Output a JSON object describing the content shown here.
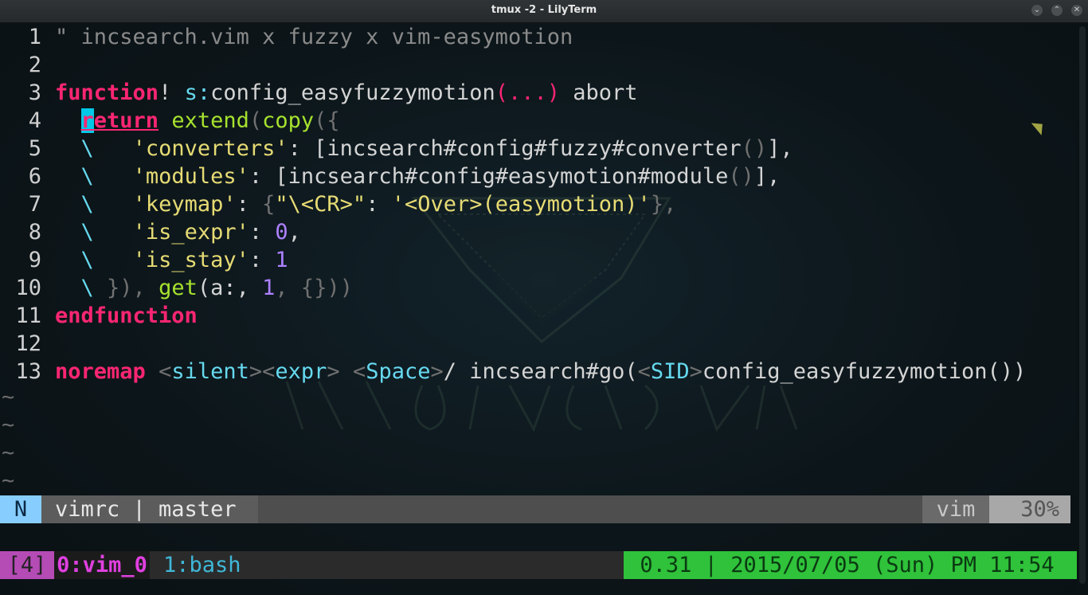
{
  "window": {
    "title": "tmux -2 - LilyTerm",
    "minimize_icon": "chevron-down-icon",
    "maximize_icon": "chevron-up-icon",
    "close_icon": "close-icon"
  },
  "editor": {
    "lines": [
      {
        "n": "1"
      },
      {
        "n": "2"
      },
      {
        "n": "3"
      },
      {
        "n": "4"
      },
      {
        "n": "5"
      },
      {
        "n": "6"
      },
      {
        "n": "7"
      },
      {
        "n": "8"
      },
      {
        "n": "9"
      },
      {
        "n": "10"
      },
      {
        "n": "11"
      },
      {
        "n": "12"
      },
      {
        "n": "13"
      }
    ],
    "code": {
      "l1": "\" incsearch.vim x fuzzy x vim-easymotion",
      "l3_kw": "function",
      "l3_bang": "!",
      "l3_s": "s:",
      "l3_name": "config_easyfuzzymotion",
      "l3_args": "(...)",
      "l3_abort": "abort",
      "l4_cursor": "r",
      "l4_ret": "eturn",
      "l4_extend": "extend",
      "l4_copy": "copy",
      "l4_paren": "({",
      "cont": "\\",
      "l5_key": "'converters'",
      "l5_val": "[incsearch#config#fuzzy#converter",
      "l5_call": "()",
      "l5_end": "],",
      "l6_key": "'modules'",
      "l6_val": "[incsearch#config#easymotion#module",
      "l6_call": "()",
      "l6_end": "],",
      "l7_key": "'keymap'",
      "l7_ob": "{",
      "l7_k": "\"\\<CR>\"",
      "l7_v": "'<Over>(easymotion)'",
      "l7_cb": "},",
      "l8_key": "'is_expr'",
      "l8_val": "0",
      "l9_key": "'is_stay'",
      "l9_val": "1",
      "l10_a": "}),",
      "l10_get": "get",
      "l10_b": "(a:, ",
      "l10_num": "1",
      "l10_c": ", {}))",
      "l11_kw": "endfunction",
      "l13_kw": "noremap",
      "l13_silent": "silent",
      "l13_expr": "expr",
      "l13_space": "Space",
      "l13_slash": "/ incsearch#go(",
      "l13_sid": "SID",
      "l13_end": "config_easyfuzzymotion())"
    },
    "tilde": "~"
  },
  "statusline": {
    "mode": "N",
    "file": "vimrc | master",
    "filetype": "vim",
    "percent": "30%"
  },
  "tmux": {
    "session": "[4]",
    "window0": "0:vim_0",
    "window1": "1:bash",
    "status_right": "0.31 | 2015/07/05 (Sun) PM 11:54"
  },
  "colors": {
    "keyword": "#f92672",
    "function": "#a6e22e",
    "scope": "#66d9ef",
    "string": "#e6db74",
    "number": "#ae81ff",
    "tmux_green": "#2fc23a"
  }
}
